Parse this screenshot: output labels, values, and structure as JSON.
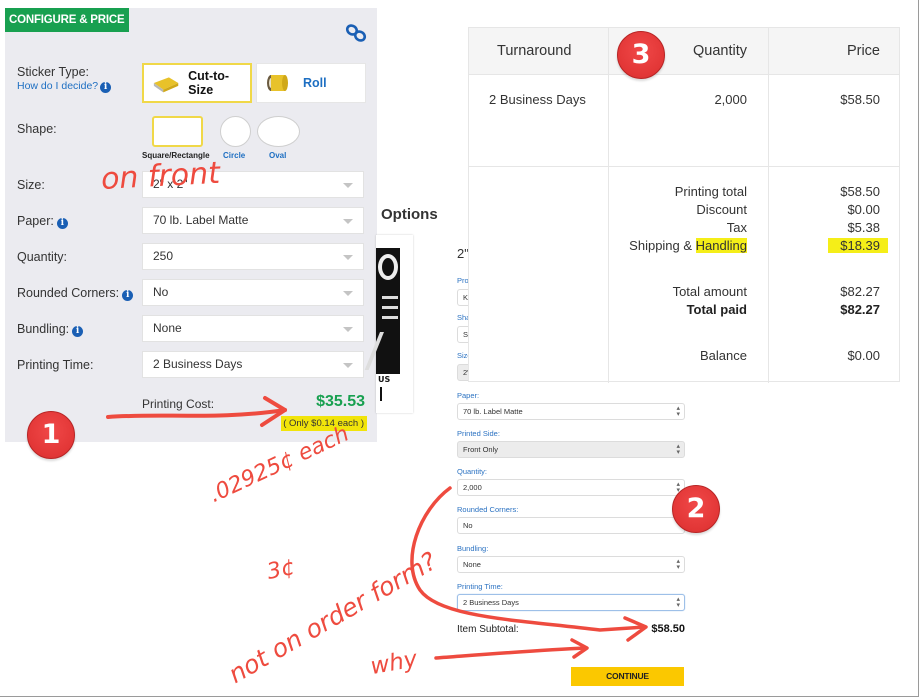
{
  "configure_panel": {
    "badge_label": "CONFIGURE & PRICE",
    "link_icon": "link-icon",
    "sticker_type_label": "Sticker Type:",
    "decide_link": "How do I decide?",
    "sticker_types": [
      {
        "label": "Cut-to-Size",
        "selected": true,
        "icon": "cut-to-size-sticker-icon"
      },
      {
        "label": "Roll",
        "selected": false,
        "icon": "roll-sticker-icon"
      }
    ],
    "shape_label": "Shape:",
    "shapes": [
      {
        "label": "Square/Rectangle",
        "selected": true
      },
      {
        "label": "Circle",
        "selected": false
      },
      {
        "label": "Oval",
        "selected": false
      }
    ],
    "fields": [
      {
        "label": "Size:",
        "value": "2\" x 2\"",
        "info": false
      },
      {
        "label": "Paper:",
        "value": "70 lb. Label Matte",
        "info": true
      },
      {
        "label": "Quantity:",
        "value": "250",
        "info": false
      },
      {
        "label": "Rounded Corners:",
        "value": "No",
        "info": true
      },
      {
        "label": "Bundling:",
        "value": "None",
        "info": true
      },
      {
        "label": "Printing Time:",
        "value": "2 Business Days",
        "info": false
      }
    ],
    "printing_cost_label": "Printing Cost:",
    "printing_cost_value": "$35.53",
    "per_each": "( Only $0.14 each )"
  },
  "options_heading": "Options",
  "product_image": {
    "visible_text": "US"
  },
  "order_form": {
    "title": "2\"",
    "partial_labels": [
      "Pro",
      "Sha",
      "Size"
    ],
    "partial_values": [
      "K",
      "Sc",
      "2\""
    ],
    "fields": [
      {
        "label": "Paper:",
        "value": "70 lb. Label Matte",
        "state": "normal"
      },
      {
        "label": "Printed Side:",
        "value": "Front Only",
        "state": "disabled"
      },
      {
        "label": "Quantity:",
        "value": "2,000",
        "state": "normal"
      },
      {
        "label": "Rounded Corners:",
        "value": "No",
        "state": "normal"
      },
      {
        "label": "Bundling:",
        "value": "None",
        "state": "normal"
      },
      {
        "label": "Printing Time:",
        "value": "2 Business Days",
        "state": "focus"
      }
    ],
    "subtotal_label": "Item Subtotal:",
    "subtotal_value": "$58.50",
    "continue_label": "CONTINUE"
  },
  "summary_table": {
    "headers": [
      "Turnaround",
      "Quantity",
      "Price"
    ],
    "row": {
      "turnaround": "2 Business Days",
      "quantity": "2,000",
      "price": "$58.50"
    },
    "totals": [
      {
        "label": "Printing total",
        "value": "$58.50",
        "bold": false,
        "highlight": false
      },
      {
        "label": "Discount",
        "value": "$0.00",
        "bold": false,
        "highlight": false
      },
      {
        "label": "Tax",
        "value": "$5.38",
        "bold": false,
        "highlight": false
      },
      {
        "label_prefix": "Shipping & ",
        "label": "Handling",
        "value": "$18.39",
        "bold": false,
        "highlight": true
      },
      {
        "label": "Total amount",
        "value": "$82.27",
        "bold": false,
        "highlight": false
      },
      {
        "label": "Total paid",
        "value": "$82.27",
        "bold": true,
        "highlight": false
      },
      {
        "label": "Balance",
        "value": "$0.00",
        "bold": false,
        "highlight": false
      }
    ]
  },
  "annotations": {
    "badges": [
      "1",
      "2",
      "3"
    ],
    "handwritten": {
      "on_front": "on front",
      "per_each": ".02925¢ each",
      "three_cents": "3¢",
      "not_on_order_form": "not on order form?",
      "why": "why"
    },
    "ink_color": "#ee4b3f",
    "highlight_color": "#f1e40a"
  },
  "colors": {
    "brand_green": "#18a050",
    "link_blue": "#1e6fc2",
    "button_yellow": "#fbc800",
    "selected_border": "#f0d848",
    "panel_bg": "#ebebf0"
  }
}
